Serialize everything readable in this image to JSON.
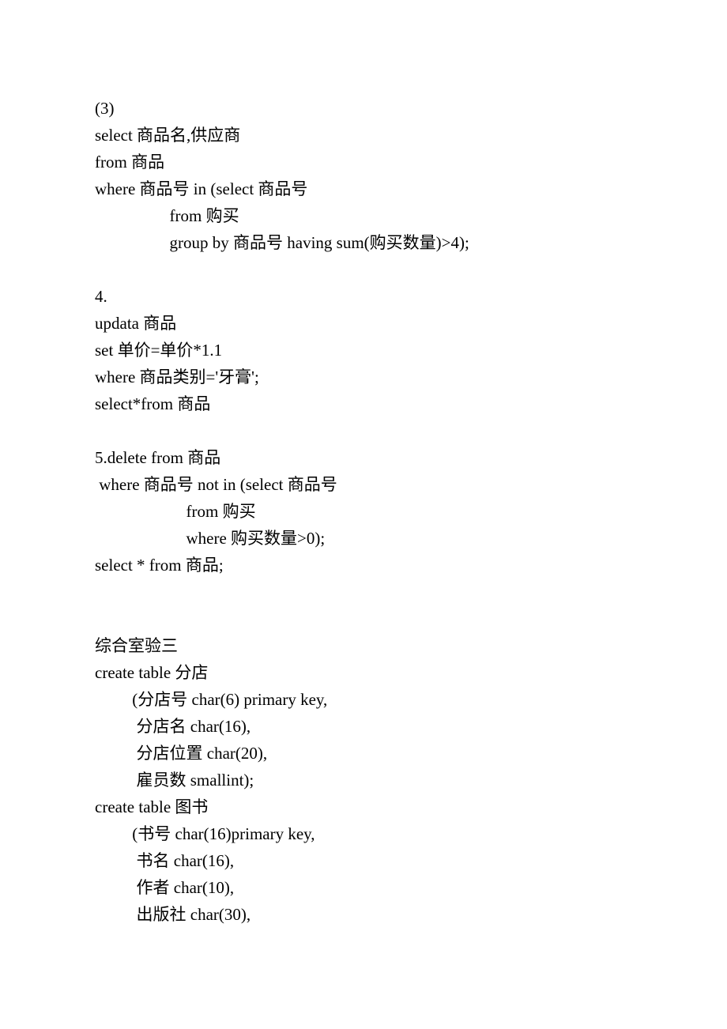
{
  "lines": [
    "(3)",
    "select 商品名,供应商",
    "from 商品",
    "where 商品号 in (select 商品号",
    "                  from 购买",
    "                  group by 商品号 having sum(购买数量)>4);",
    "",
    "4.",
    "updata 商品",
    "set 单价=单价*1.1",
    "where 商品类别='牙膏';",
    "select*from 商品",
    "",
    "5.delete from 商品",
    " where 商品号 not in (select 商品号",
    "                      from 购买",
    "                      where 购买数量>0);",
    "select * from 商品;",
    "",
    "",
    "综合室验三",
    "create table 分店",
    "         (分店号 char(6) primary key,",
    "          分店名 char(16),",
    "          分店位置 char(20),",
    "          雇员数 smallint);",
    "create table 图书",
    "         (书号 char(16)primary key,",
    "          书名 char(16),",
    "          作者 char(10),",
    "          出版社 char(30),"
  ]
}
